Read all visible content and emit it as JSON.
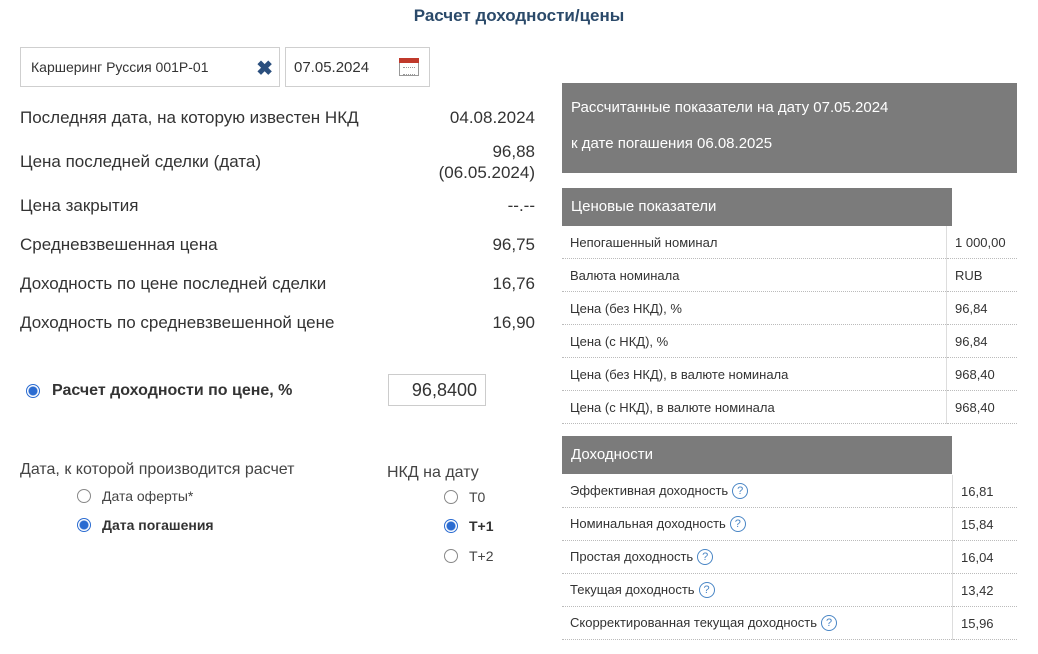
{
  "page": {
    "title": "Расчет доходности/цены"
  },
  "controls": {
    "bond_name": "Каршеринг Руссия 001Р-01",
    "date": "07.05.2024"
  },
  "info": [
    {
      "label": "Последняя дата, на которую известен НКД",
      "value": "04.08.2024"
    },
    {
      "label": "Цена последней сделки (дата)",
      "value": "96,88",
      "value2": "(06.05.2024)"
    },
    {
      "label": "Цена закрытия",
      "value": "--.--"
    },
    {
      "label": "Средневзвешенная цена",
      "value": "96,75"
    },
    {
      "label": "Доходность по цене последней сделки",
      "value": "16,76"
    },
    {
      "label": "Доходность по средневзвешенной цене",
      "value": "16,90"
    }
  ],
  "calc": {
    "label": "Расчет доходности по цене, %",
    "value": "96,8400"
  },
  "calc_date": {
    "label": "Дата, к которой производится расчет",
    "options": [
      {
        "label": "Дата оферты*",
        "selected": false
      },
      {
        "label": "Дата погашения",
        "selected": true
      }
    ]
  },
  "nkd": {
    "label": "НКД на дату",
    "options": [
      {
        "label": "T0",
        "selected": false
      },
      {
        "label": "T+1",
        "selected": true
      },
      {
        "label": "T+2",
        "selected": false
      }
    ]
  },
  "summary": {
    "line1": "Рассчитанные показатели на дату 07.05.2024",
    "line2": "к дате погашения 06.08.2025"
  },
  "price_table": {
    "header": "Ценовые показатели",
    "rows": [
      {
        "label": "Непогашенный номинал",
        "value": "1 000,00"
      },
      {
        "label": "Валюта номинала",
        "value": "RUB"
      },
      {
        "label": "Цена (без НКД), %",
        "value": "96,84"
      },
      {
        "label": "Цена (с НКД), %",
        "value": "96,84"
      },
      {
        "label": "Цена (без НКД), в валюте номинала",
        "value": "968,40"
      },
      {
        "label": "Цена (с НКД), в валюте номинала",
        "value": "968,40"
      }
    ]
  },
  "yield_table": {
    "header": "Доходности",
    "rows": [
      {
        "label": "Эффективная доходность",
        "value": "16,81"
      },
      {
        "label": "Номинальная доходность",
        "value": "15,84"
      },
      {
        "label": "Простая доходность",
        "value": "16,04"
      },
      {
        "label": "Текущая доходность",
        "value": "13,42"
      },
      {
        "label": "Скорректированная текущая доходность",
        "value": "15,96"
      }
    ]
  },
  "icons": {
    "clear": "close-icon",
    "calendar": "calendar-icon",
    "help": "help-icon",
    "help_glyph": "?"
  },
  "colors": {
    "title": "#2b4a6a",
    "header_bg": "#7b7b7b",
    "radio_selected": "#2a6bd1",
    "clear_icon": "#2b4f7e"
  }
}
